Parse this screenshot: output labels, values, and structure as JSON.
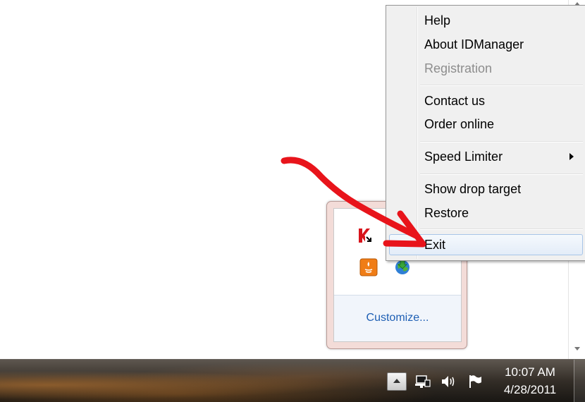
{
  "context_menu": {
    "items": [
      {
        "label": "Help",
        "enabled": true
      },
      {
        "label": "About IDManager",
        "enabled": true
      },
      {
        "label": "Registration",
        "enabled": false
      },
      {
        "label": "Contact us",
        "enabled": true
      },
      {
        "label": "Order online",
        "enabled": true
      },
      {
        "label": "Speed Limiter",
        "enabled": true,
        "submenu": true
      },
      {
        "label": "Show drop target",
        "enabled": true
      },
      {
        "label": "Restore",
        "enabled": true
      },
      {
        "label": "Exit",
        "enabled": true,
        "highlighted": true
      }
    ]
  },
  "tray_flyout": {
    "icons": [
      "kaspersky-icon",
      "java-update-icon",
      "internet-download-manager-icon"
    ],
    "customize_label": "Customize..."
  },
  "taskbar": {
    "clock_time": "10:07 AM",
    "clock_date": "4/28/2011",
    "icons": [
      "show-hidden-icons-arrow",
      "network-icon",
      "volume-icon",
      "action-center-flag-icon"
    ]
  },
  "colors": {
    "annotation_arrow": "#e8141b",
    "menu_background": "#f0f0f0",
    "menu_highlight_border": "#a8c5e8",
    "link": "#1e5fb4"
  }
}
